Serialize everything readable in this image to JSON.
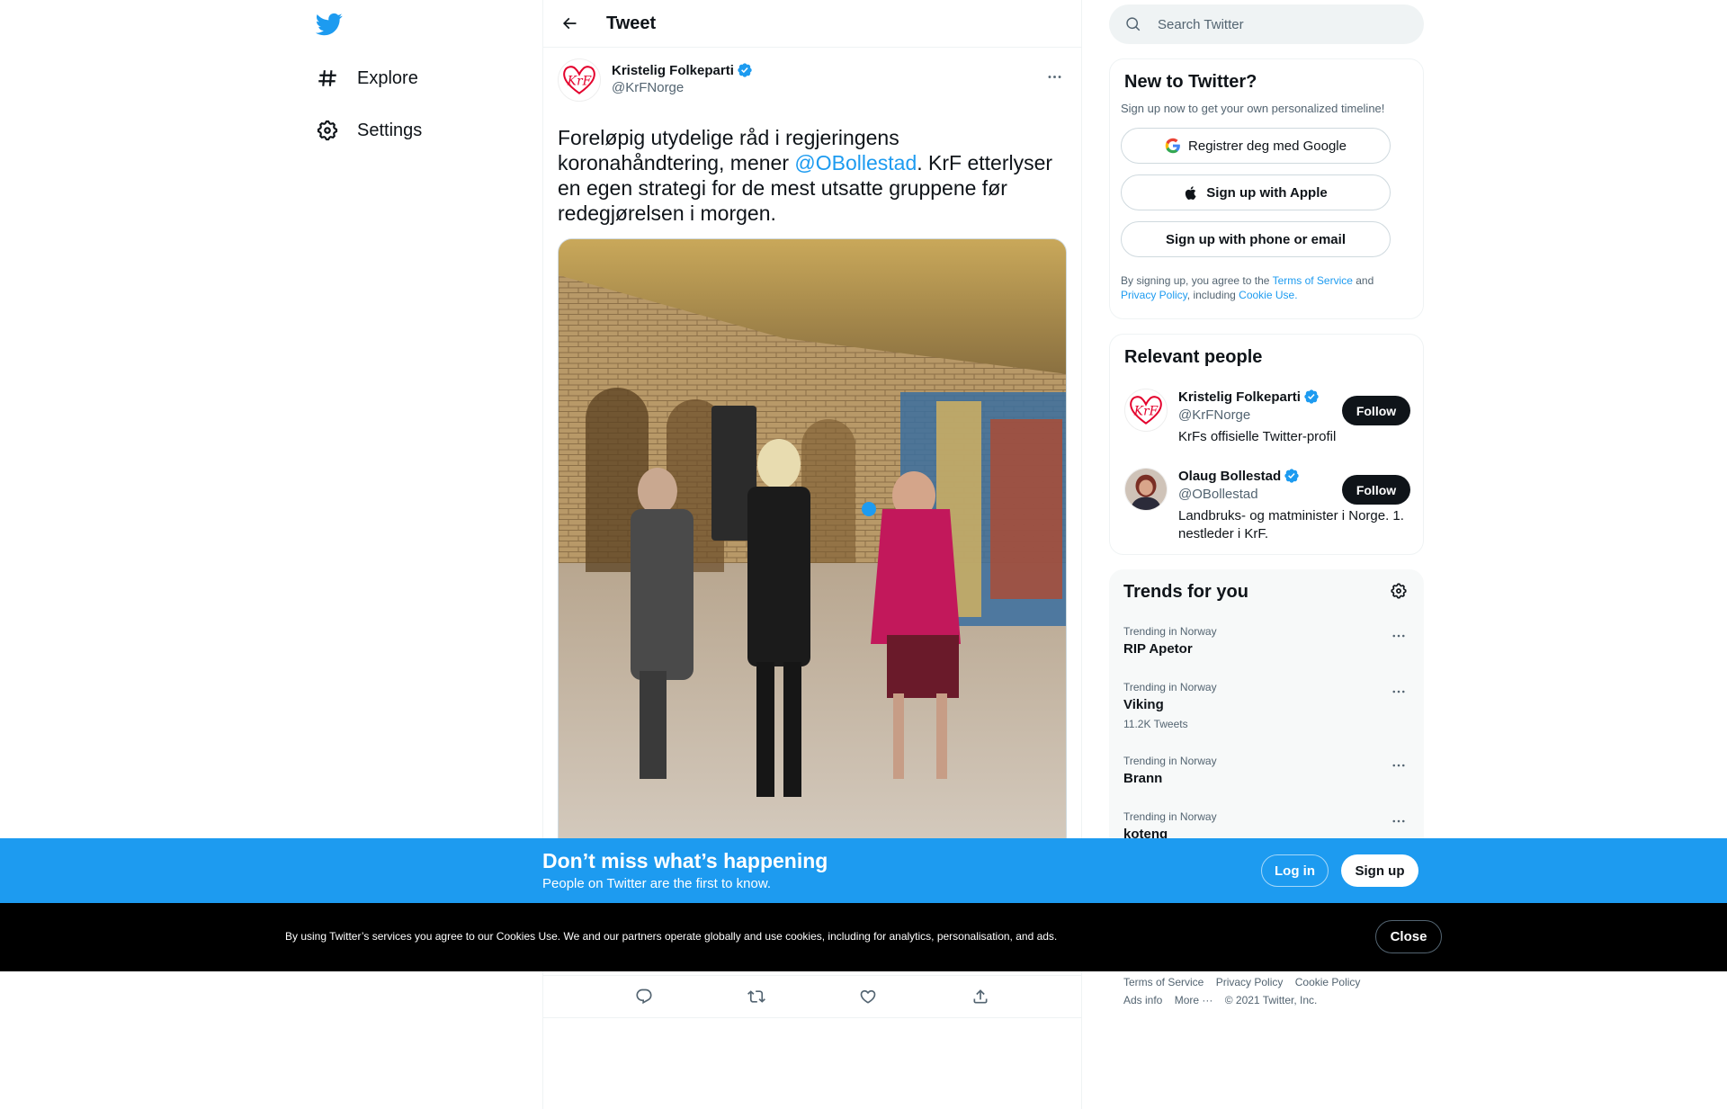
{
  "nav": {
    "items": [
      {
        "label": "Explore",
        "icon": "hashtag-icon"
      },
      {
        "label": "Settings",
        "icon": "gear-icon"
      }
    ]
  },
  "header": {
    "title": "Tweet"
  },
  "tweet": {
    "author_name": "Kristelig Folkeparti",
    "author_handle": "@KrFNorge",
    "avatar_text": "KrF",
    "text_before": "Foreløpig utydelige råd i regjeringens koronahåndtering, mener ",
    "mention": "@OBollestad",
    "text_after": ". KrF etterlyser en egen strategi for de mest utsatte gruppene før redegjørelsen i morgen."
  },
  "search": {
    "placeholder": "Search Twitter"
  },
  "signup_card": {
    "title": "New to Twitter?",
    "subtitle": "Sign up now to get your own personalized timeline!",
    "google": "Registrer deg med Google",
    "apple": "Sign up with Apple",
    "phone": "Sign up with phone or email",
    "terms_prefix": "By signing up, you agree to the ",
    "terms_link": "Terms of Service",
    "terms_and": " and ",
    "privacy_link": "Privacy Policy",
    "including": ", including ",
    "cookie_link": "Cookie Use."
  },
  "people": {
    "title": "Relevant people",
    "list": [
      {
        "name": "Kristelig Folkeparti",
        "handle": "@KrFNorge",
        "bio": "KrFs offisielle Twitter-profil",
        "button": "Follow"
      },
      {
        "name": "Olaug Bollestad",
        "handle": "@OBollestad",
        "bio": "Landbruks- og matminister i Norge. 1. nestleder i KrF.",
        "button": "Follow"
      }
    ]
  },
  "trends": {
    "title": "Trends for you",
    "list": [
      {
        "context": "Trending in Norway",
        "name": "RIP Apetor",
        "count": ""
      },
      {
        "context": "Trending in Norway",
        "name": "Viking",
        "count": "11.2K Tweets"
      },
      {
        "context": "Trending in Norway",
        "name": "Brann",
        "count": ""
      },
      {
        "context": "Trending in Norway",
        "name": "koteng",
        "count": ""
      }
    ]
  },
  "footer": {
    "terms": "Terms of Service",
    "privacy": "Privacy Policy",
    "cookie": "Cookie Policy",
    "ads": "Ads info",
    "more": "More ···",
    "copyright": "© 2021 Twitter, Inc."
  },
  "promo": {
    "title": "Don’t miss what’s happening",
    "subtitle": "People on Twitter are the first to know.",
    "login": "Log in",
    "signup": "Sign up"
  },
  "cookie_bar": {
    "text": "By using Twitter’s services you agree to our Cookies Use. We and our partners operate globally and use cookies, including for analytics, personalisation, and ads.",
    "close": "Close"
  },
  "colors": {
    "accent": "#1d9bf0",
    "text": "#0f1419",
    "secondary": "#536471",
    "cookie_bg": "#000000"
  }
}
